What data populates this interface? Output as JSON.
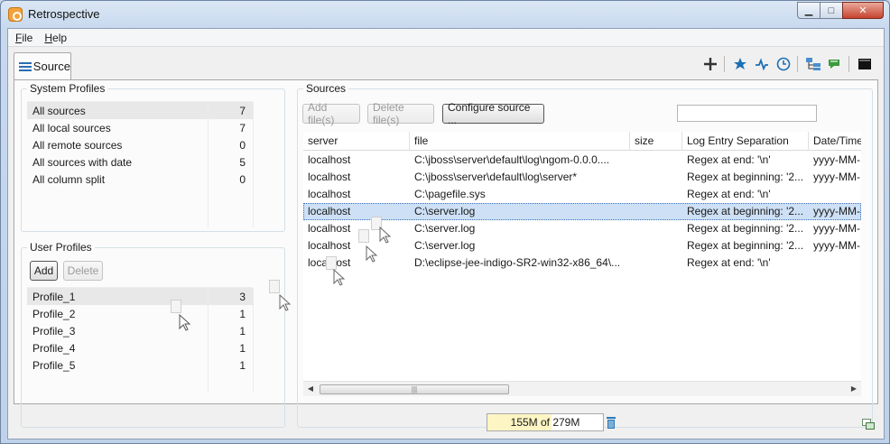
{
  "window": {
    "title": "Retrospective",
    "minimize": "▁",
    "maximize": "□",
    "close": "✕"
  },
  "menu": [
    {
      "label": "File"
    },
    {
      "label": "Help"
    }
  ],
  "tab": {
    "label": "Source"
  },
  "toolbar": {
    "icons": [
      "add-icon",
      "star-icon",
      "pulse-icon",
      "clock-icon",
      "tree-icon",
      "comment-icon",
      "terminal-icon"
    ]
  },
  "system_profiles": {
    "title": "System Profiles",
    "items": [
      {
        "label": "All sources",
        "count": "7"
      },
      {
        "label": "All local sources",
        "count": "7"
      },
      {
        "label": "All remote sources",
        "count": "0"
      },
      {
        "label": "All sources with date",
        "count": "5"
      },
      {
        "label": "All column split",
        "count": "0"
      }
    ]
  },
  "user_profiles": {
    "title": "User Profiles",
    "add_label": "Add",
    "delete_label": "Delete",
    "items": [
      {
        "label": "Profile_1",
        "count": "3"
      },
      {
        "label": "Profile_2",
        "count": "1"
      },
      {
        "label": "Profile_3",
        "count": "1"
      },
      {
        "label": "Profile_4",
        "count": "1"
      },
      {
        "label": "Profile_5",
        "count": "1"
      }
    ]
  },
  "sources": {
    "title": "Sources",
    "add_files_label": "Add file(s)",
    "delete_files_label": "Delete file(s)",
    "configure_label": "Configure source ...",
    "search_placeholder": "",
    "columns": [
      "server",
      "file",
      "size",
      "Log Entry Separation",
      "Date/Time"
    ],
    "rows": [
      {
        "server": "localhost",
        "file": "C:\\jboss\\server\\default\\log\\ngom-0.0.0....",
        "size": "",
        "separation": "Regex at end: '\\n'",
        "datetime": "yyyy-MM-"
      },
      {
        "server": "localhost",
        "file": "C:\\jboss\\server\\default\\log\\server*",
        "size": "",
        "separation": "Regex at beginning: '2...",
        "datetime": "yyyy-MM-"
      },
      {
        "server": "localhost",
        "file": "C:\\pagefile.sys",
        "size": "",
        "separation": "Regex at end: '\\n'",
        "datetime": ""
      },
      {
        "server": "localhost",
        "file": "C:\\server.log",
        "size": "",
        "separation": "Regex at beginning: '2...",
        "datetime": "yyyy-MM-"
      },
      {
        "server": "localhost",
        "file": "C:\\server.log",
        "size": "",
        "separation": "Regex at beginning: '2...",
        "datetime": "yyyy-MM-"
      },
      {
        "server": "localhost",
        "file": "C:\\server.log",
        "size": "",
        "separation": "Regex at beginning: '2...",
        "datetime": "yyyy-MM-"
      },
      {
        "server": "localhost",
        "file": "D:\\eclipse-jee-indigo-SR2-win32-x86_64\\...",
        "size": "",
        "separation": "Regex at end: '\\n'",
        "datetime": ""
      }
    ]
  },
  "status": {
    "memory_text": "155M of 279M",
    "memory_used_fraction": 0.556
  }
}
